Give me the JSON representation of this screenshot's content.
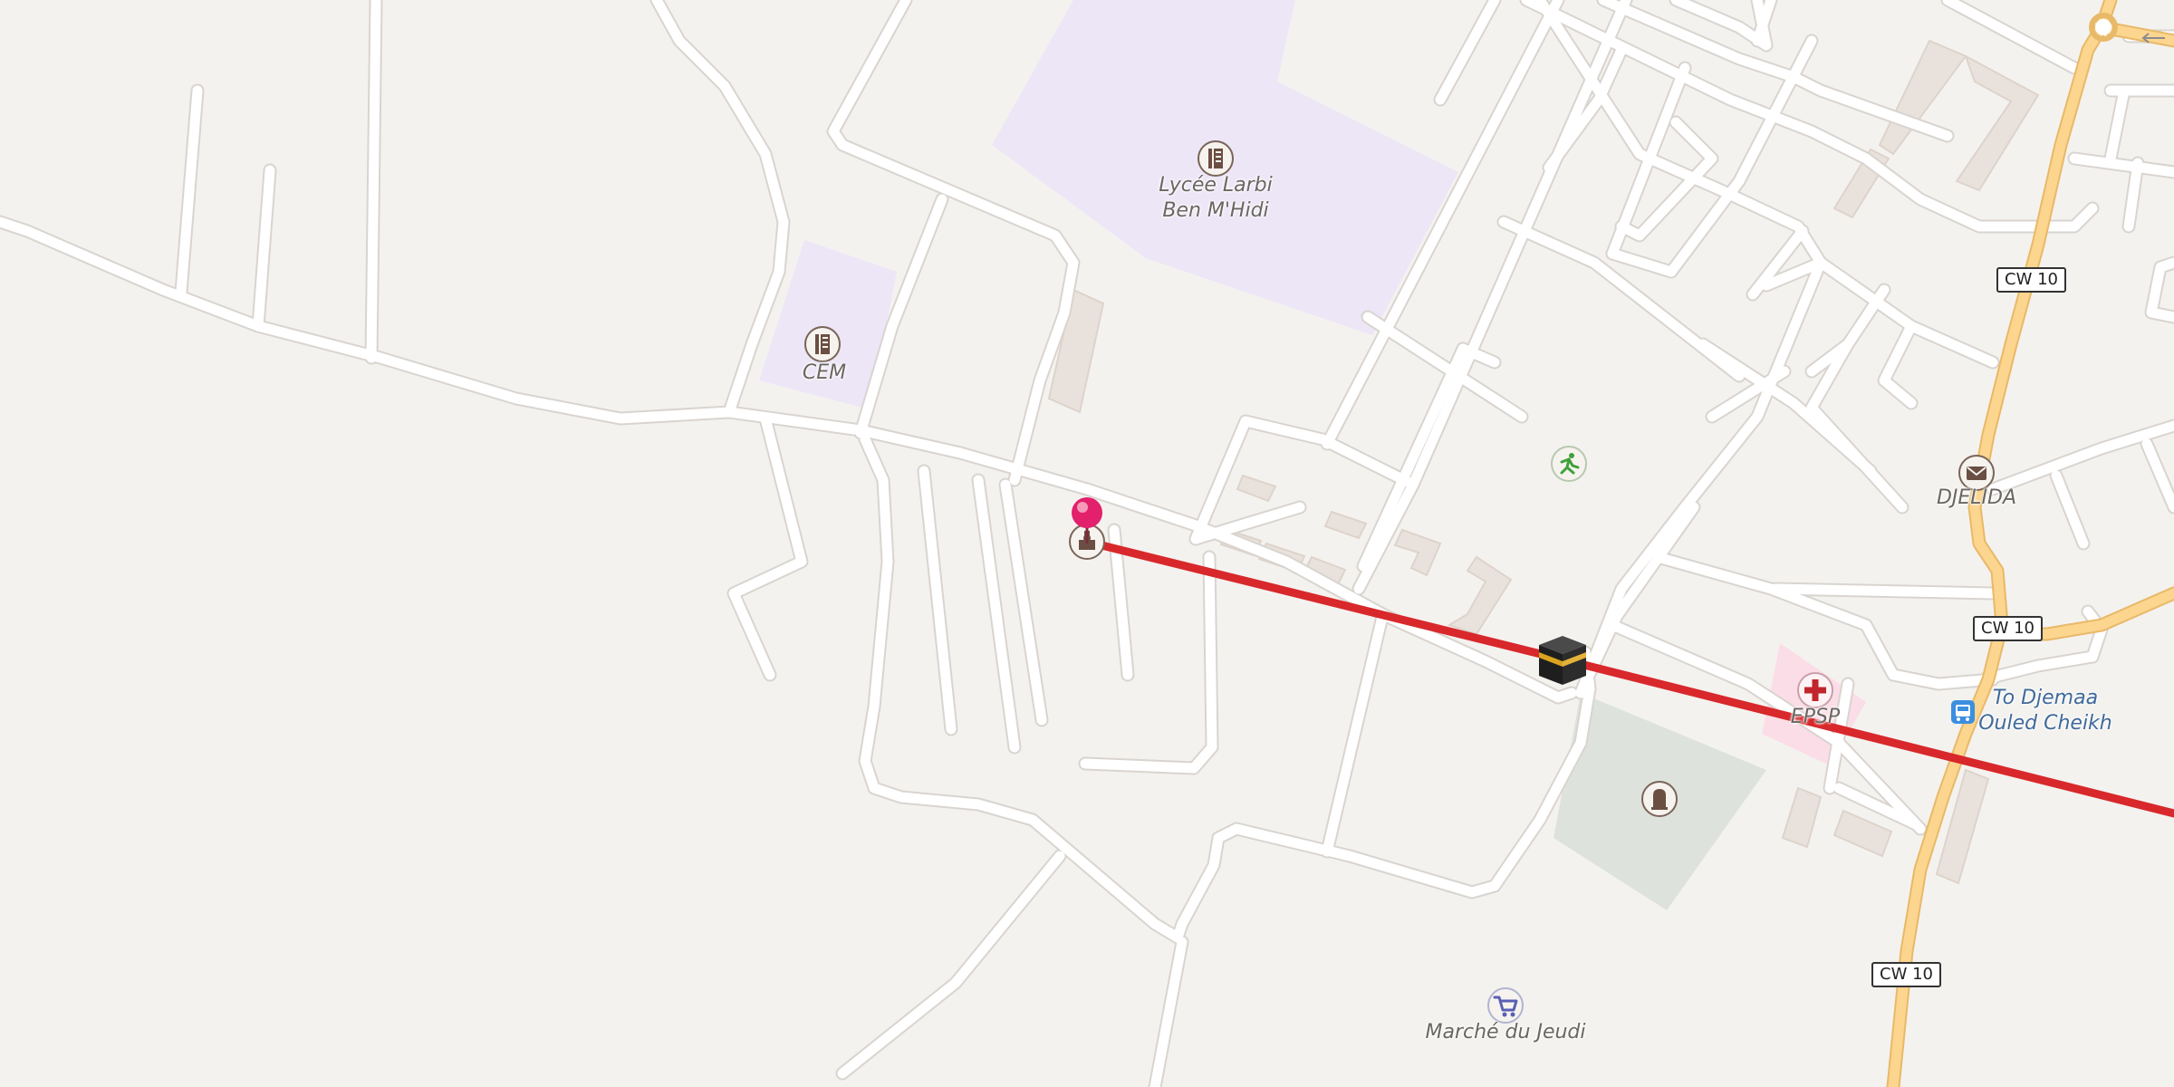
{
  "map": {
    "labels": {
      "lycee_line1": "Lycée Larbi",
      "lycee_line2": "Ben M'Hidi",
      "cem": "CEM",
      "djelida": "DJELIDA",
      "epsp": "EPSP",
      "djemaa_line1": "To Djemaa",
      "djemaa_line2": "Ouled Cheikh",
      "marche": "Marché du Jeudi"
    },
    "road_refs": [
      "CW 10",
      "CW 10",
      "CW 10"
    ],
    "icons": [
      "school-icon",
      "school-icon",
      "mosque-icon",
      "kaaba-icon",
      "pin-marker-icon",
      "sports-icon",
      "post-office-icon",
      "hospital-icon",
      "bus-stop-icon",
      "cemetery-icon",
      "shopping-cart-icon"
    ],
    "colors": {
      "background": "#f4f2ef",
      "road": "#ffffff",
      "road_casing": "#d9d4cf",
      "primary_road": "#fcd58f",
      "primary_road_casing": "#e8b968",
      "school_area": "#ece6f7",
      "hospital_area": "#fbdde7",
      "cemetery_area": "#dde3dc",
      "building": "#e9e2dc",
      "route_line": "#d8282b",
      "pin": "#e3206b"
    }
  }
}
